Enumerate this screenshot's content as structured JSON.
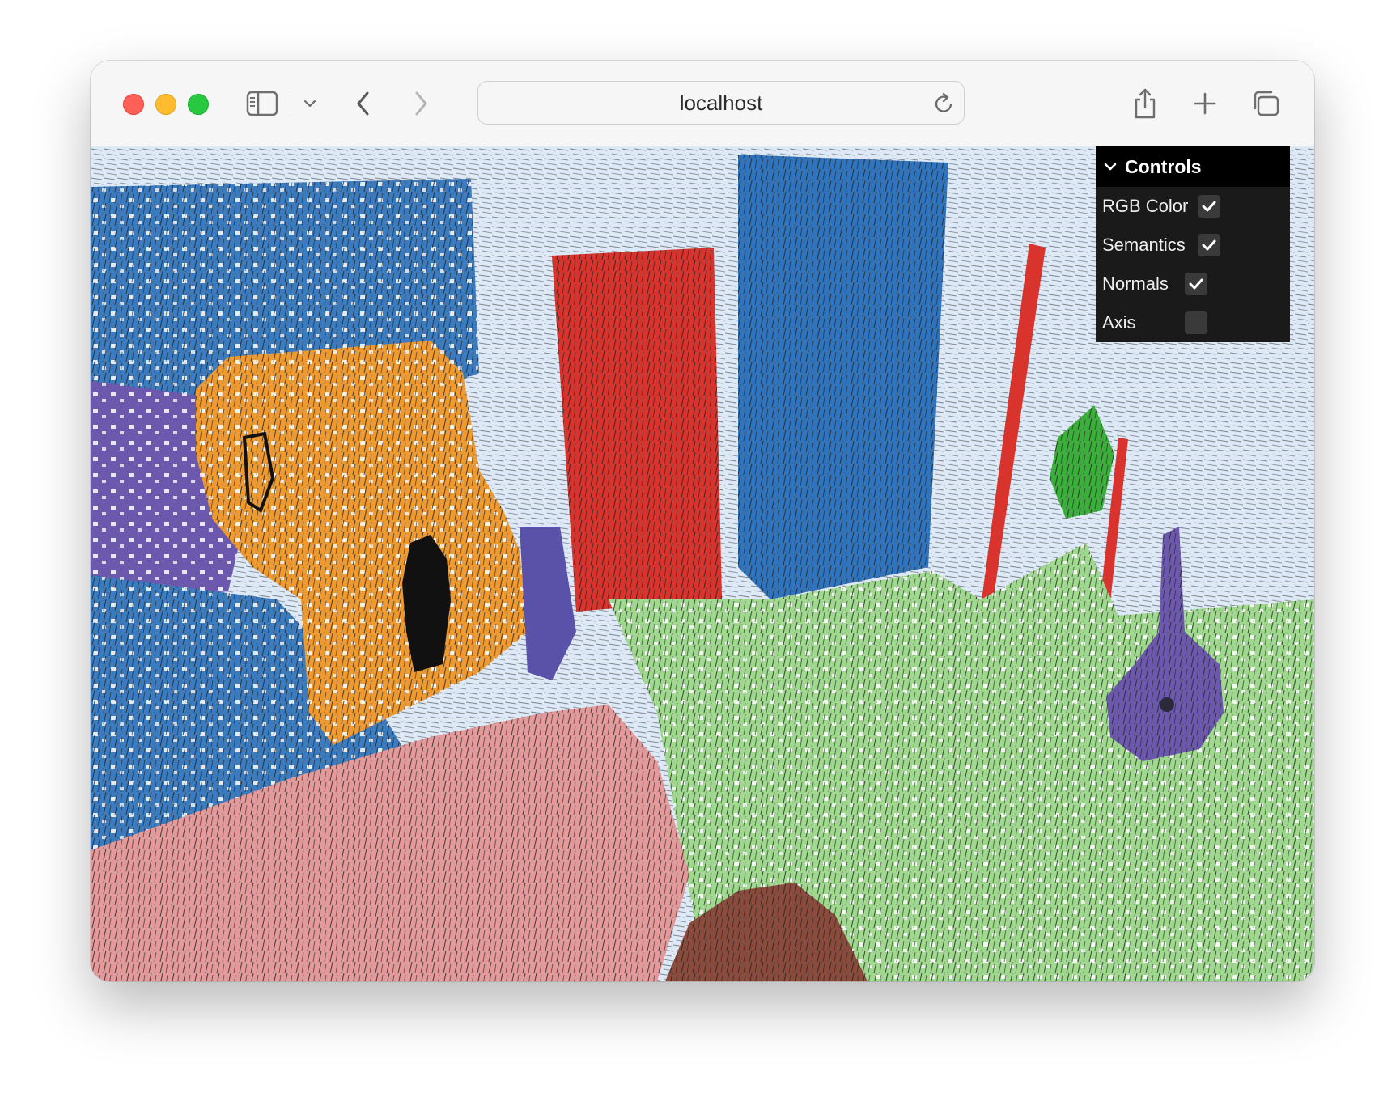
{
  "window": {
    "controls": [
      "close",
      "minimize",
      "zoom"
    ]
  },
  "toolbar": {
    "sidebar_icon": "sidebar-icon",
    "tab_menu_icon": "chevron-down-icon",
    "back_icon": "chevron-left-icon",
    "forward_icon": "chevron-right-icon",
    "share_icon": "share-icon",
    "new_tab_icon": "plus-icon",
    "tabs_overview_icon": "tabs-overview-icon"
  },
  "address_bar": {
    "url": "localhost",
    "reload_icon": "reload-icon"
  },
  "viewer": {
    "description_icon": "point-cloud-viewport"
  },
  "controls_panel": {
    "title": "Controls",
    "items": [
      {
        "label": "RGB Color",
        "checked": true
      },
      {
        "label": "Semantics",
        "checked": true
      },
      {
        "label": "Normals",
        "checked": true
      },
      {
        "label": "Axis",
        "checked": false
      }
    ]
  },
  "colors": {
    "wall": "#dde9f6",
    "sofa_blue": "#3b7cc0",
    "red_panel": "#d8332c",
    "blue_panel": "#2f74bd",
    "orange_bear": "#ee9a31",
    "floor_green": "#9fd98e",
    "rug_pink": "#e49a9a",
    "purple": "#6c58ad",
    "green_plant": "#3cae3c",
    "brown": "#8a4a3c"
  }
}
